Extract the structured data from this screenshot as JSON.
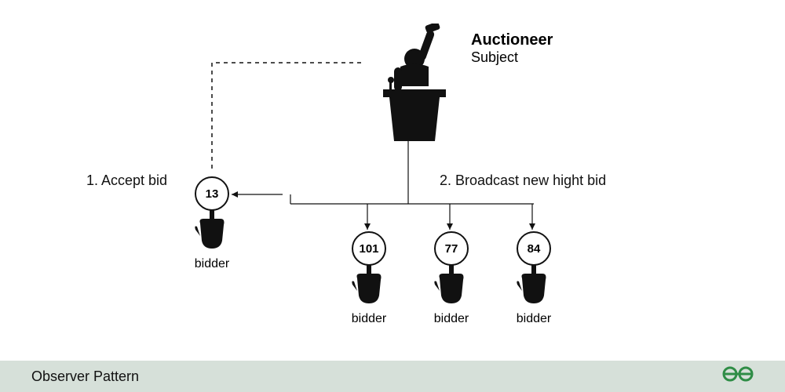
{
  "diagram": {
    "auctioneer": {
      "title": "Auctioneer",
      "subtitle": "Subject"
    },
    "step1": "1. Accept bid",
    "step2": "2. Broadcast new hight bid",
    "bidders": [
      {
        "number": "13",
        "label": "bidder"
      },
      {
        "number": "101",
        "label": "bidder"
      },
      {
        "number": "77",
        "label": "bidder"
      },
      {
        "number": "84",
        "label": "bidder"
      }
    ]
  },
  "footer": {
    "title": "Observer Pattern",
    "brand": "GG"
  },
  "colors": {
    "footer_bg": "#d6e0d9",
    "brand": "#2f8d46",
    "ink": "#111111"
  }
}
